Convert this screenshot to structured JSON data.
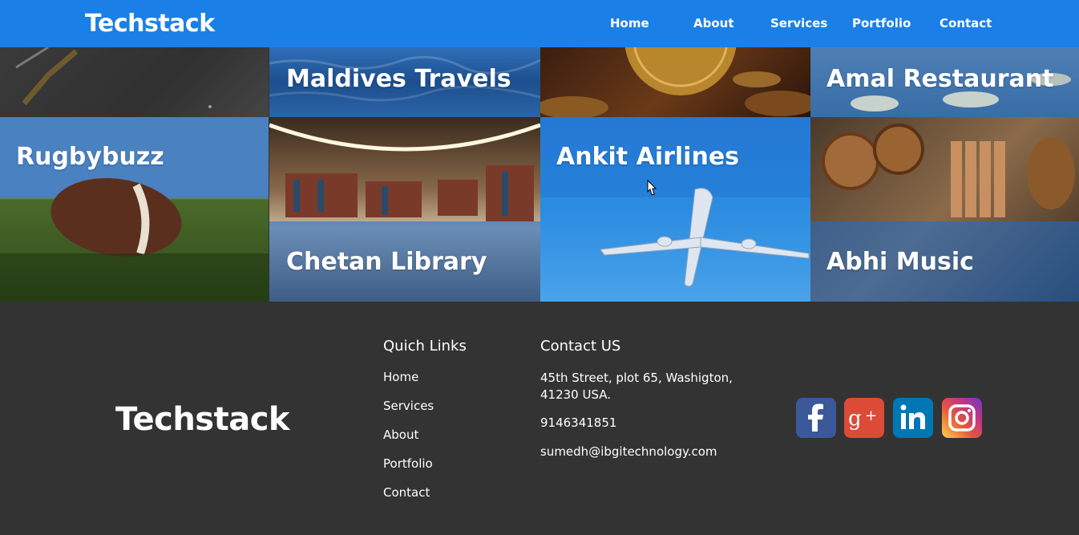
{
  "nav": {
    "brand": "Techstack",
    "links": [
      "Home",
      "About",
      "Services",
      "Portfolio",
      "Contact"
    ]
  },
  "portfolio": {
    "tiles": [
      {
        "title": ""
      },
      {
        "title": "Maldives Travels"
      },
      {
        "title": ""
      },
      {
        "title": "Amal Restaurant"
      },
      {
        "title": "Rugbybuzz"
      },
      {
        "title": "Chetan Library"
      },
      {
        "title": "Ankit Airlines"
      },
      {
        "title": "Abhi Music"
      }
    ]
  },
  "footer": {
    "brand": "Techstack",
    "quick_links": {
      "heading": "Quich Links",
      "items": [
        "Home",
        "Services",
        "About",
        "Portfolio",
        "Contact"
      ]
    },
    "contact": {
      "heading": "Contact US",
      "address": "45th Street, plot 65, Washigton, 41230 USA.",
      "phone": "9146341851",
      "email": "sumedh@ibgitechnology.com"
    },
    "social": [
      {
        "icon": "facebook-icon",
        "color": "#3b5998"
      },
      {
        "icon": "google-plus-icon",
        "color": "#dc4a38"
      },
      {
        "icon": "linkedin-icon",
        "color": "#0077b5"
      },
      {
        "icon": "instagram-icon",
        "color": "#c13584"
      }
    ]
  },
  "colors": {
    "nav_bg": "#1b7fe8",
    "footer_bg": "#333333",
    "overlay": "#1b6ecd"
  }
}
